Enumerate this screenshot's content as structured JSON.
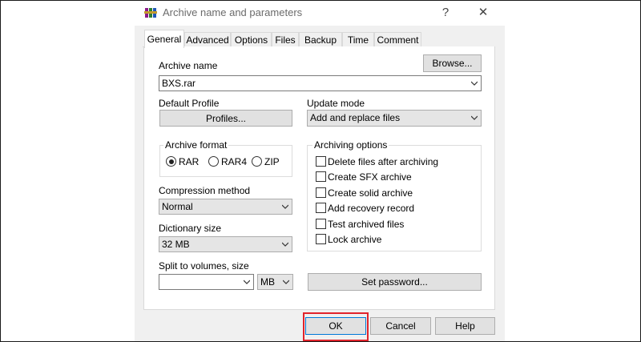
{
  "window": {
    "title": "Archive name and parameters",
    "help_glyph": "?",
    "close_glyph": "✕"
  },
  "tabs": [
    {
      "label": "General",
      "active": true
    },
    {
      "label": "Advanced"
    },
    {
      "label": "Options"
    },
    {
      "label": "Files"
    },
    {
      "label": "Backup"
    },
    {
      "label": "Time"
    },
    {
      "label": "Comment"
    }
  ],
  "general": {
    "archive_name_label": "Archive name",
    "browse_label": "Browse...",
    "archive_name_value": "BXS.rar",
    "default_profile_label": "Default Profile",
    "profiles_label": "Profiles...",
    "update_mode_label": "Update mode",
    "update_mode_value": "Add and replace files",
    "archive_format": {
      "legend": "Archive format",
      "options": [
        "RAR",
        "RAR4",
        "ZIP"
      ],
      "selected": "RAR"
    },
    "compression_method_label": "Compression method",
    "compression_method_value": "Normal",
    "dictionary_size_label": "Dictionary size",
    "dictionary_size_value": "32 MB",
    "split_label": "Split to volumes, size",
    "split_value": "",
    "split_unit": "MB",
    "archiving_options": {
      "legend": "Archiving options",
      "items": [
        {
          "label": "Delete files after archiving",
          "checked": false
        },
        {
          "label": "Create SFX archive",
          "checked": false
        },
        {
          "label": "Create solid archive",
          "checked": false
        },
        {
          "label": "Add recovery record",
          "checked": false
        },
        {
          "label": "Test archived files",
          "checked": false
        },
        {
          "label": "Lock archive",
          "checked": false
        }
      ]
    },
    "set_password_label": "Set password..."
  },
  "footer": {
    "ok_label": "OK",
    "cancel_label": "Cancel",
    "help_label": "Help"
  },
  "colors": {
    "highlight": "#e0232b",
    "dialog_bg": "#f0f0f0",
    "button_bg": "#e1e1e1"
  },
  "icons": {
    "app": "winrar-books-icon",
    "dropdown": "chevron-down-icon"
  }
}
